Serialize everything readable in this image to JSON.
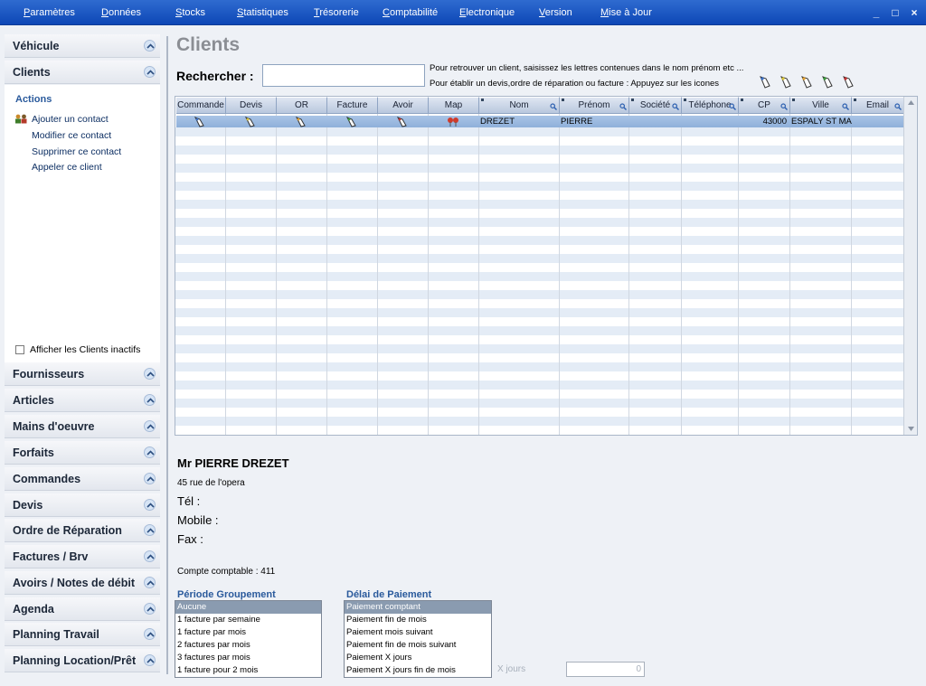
{
  "menu": [
    "Paramètres",
    "Données",
    "Stocks",
    "Statistiques",
    "Trésorerie",
    "Comptabilité",
    "Electronique",
    "Version",
    "Mise à Jour"
  ],
  "window_controls": {
    "minimize": "_",
    "maximize": "□",
    "close": "×"
  },
  "sidebar": {
    "top_sections": [
      "Véhicule",
      "Clients"
    ],
    "actions_title": "Actions",
    "actions": [
      "Ajouter un contact",
      "Modifier ce contact",
      "Supprimer ce contact",
      "Appeler ce client"
    ],
    "show_inactive": "Afficher les Clients inactifs",
    "sections": [
      "Fournisseurs",
      "Articles",
      "Mains d'oeuvre",
      "Forfaits",
      "Commandes",
      "Devis",
      "Ordre de Réparation",
      "Factures / Brv",
      "Avoirs / Notes de débit",
      "Agenda",
      "Planning Travail",
      "Planning Location/Prêt"
    ]
  },
  "page": {
    "title": "Clients",
    "search_label": "Rechercher :",
    "search_value": "",
    "hint1": "Pour retrouver un client, saisissez les lettres contenues dans le nom prénom etc ...",
    "hint2": "Pour établir un devis,ordre de réparation ou facture : Appuyez sur les icones"
  },
  "grid": {
    "columns": [
      "Commande",
      "Devis",
      "OR",
      "Facture",
      "Avoir",
      "Map",
      "Nom",
      "Prénom",
      "Société",
      "Téléphone",
      "CP",
      "Ville",
      "Email"
    ],
    "rows": [
      {
        "nom": "DREZET",
        "prenom": "PIERRE",
        "societe": "",
        "telephone": "",
        "cp": "43000",
        "ville": "ESPALY ST MA",
        "email": ""
      }
    ]
  },
  "detail": {
    "name": "Mr PIERRE DREZET",
    "address": "45 rue de l'opera",
    "tel": "Tél :",
    "mobile": "Mobile :",
    "fax": "Fax :",
    "compte": "Compte comptable : 411"
  },
  "periode": {
    "title": "Période Groupement",
    "options": [
      "Aucune",
      "1 facture par semaine",
      "1 facture par mois",
      "2 factures par mois",
      "3 factures par mois",
      "1 facture  pour 2 mois"
    ],
    "selected": 0
  },
  "delai": {
    "title": "Délai de Paiement",
    "options": [
      "Paiement comptant",
      "Paiement fin de mois",
      "Paiement mois suivant",
      "Paiement fin de mois suivant",
      "Paiement X jours",
      "Paiement X jours fin de mois"
    ],
    "selected": 0
  },
  "xjours": {
    "label": "X jours",
    "value": "0"
  },
  "colors": {
    "menubar": "#0d47b6",
    "accent": "#2a5a9c",
    "row_selected": "#9db9e0",
    "row_alt": "#e4ecf6"
  }
}
